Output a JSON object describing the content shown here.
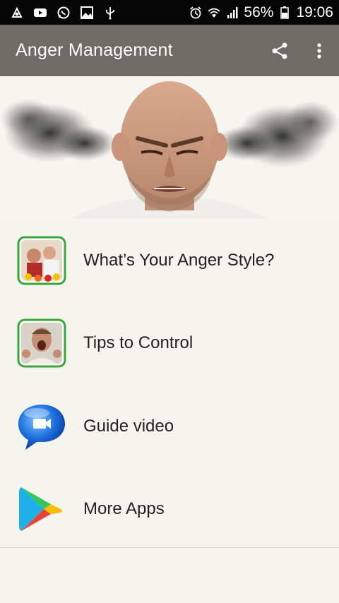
{
  "status_bar": {
    "icons": [
      "android-debug-icon",
      "youtube-icon",
      "whatsapp-icon",
      "gallery-icon",
      "usb-icon",
      "alarm-icon",
      "wifi-icon",
      "signal-icon",
      "battery-icon"
    ],
    "battery": "56%",
    "time": "19:06"
  },
  "app_bar": {
    "title": "Anger Management",
    "actions": [
      "share-icon",
      "overflow-menu-icon"
    ]
  },
  "hero": {
    "image": "angry-man-steam-from-ears"
  },
  "menu": {
    "items": [
      {
        "label": "What’s Your Anger Style?",
        "icon": "anger-style-thumbnail"
      },
      {
        "label": "Tips to Control",
        "icon": "screaming-man-thumbnail"
      },
      {
        "label": "Guide video",
        "icon": "video-chat-bubble-icon"
      },
      {
        "label": "More Apps",
        "icon": "google-play-icon"
      }
    ]
  },
  "colors": {
    "status_bar": "#050505",
    "app_bar": "#6f6c68",
    "background": "#f6f4ef",
    "thumbnail_border": "#3aa637"
  }
}
